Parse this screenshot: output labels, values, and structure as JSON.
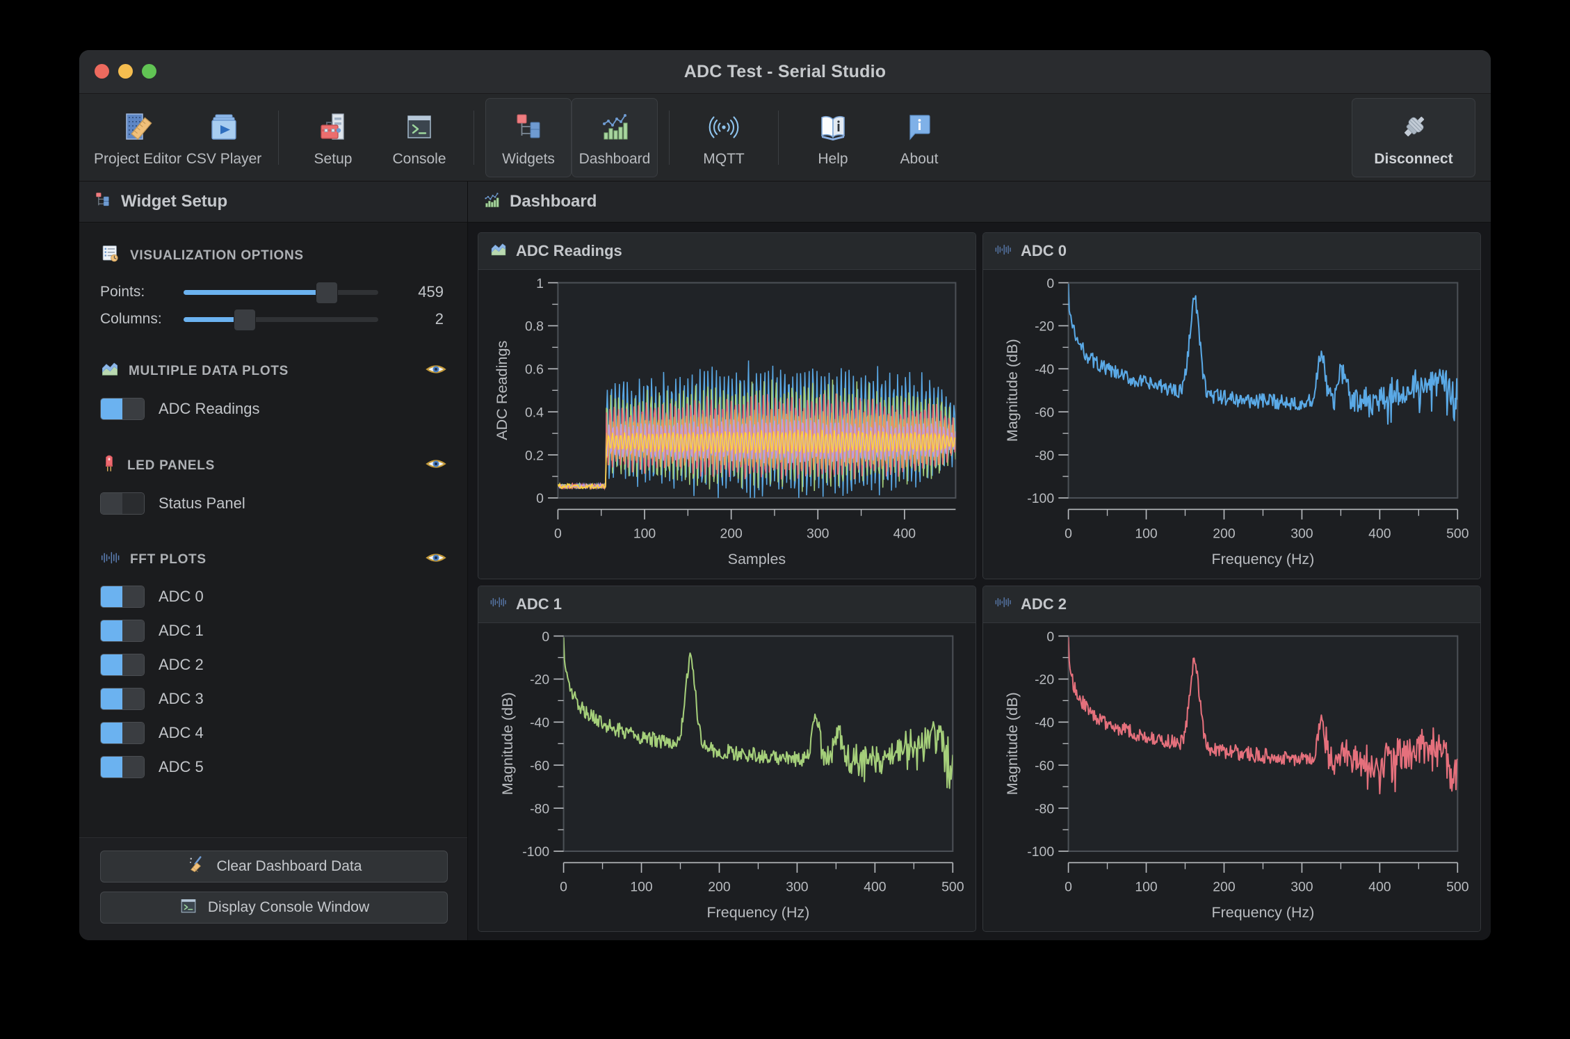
{
  "window": {
    "title": "ADC Test - Serial Studio",
    "traffic_lights": [
      "close-red",
      "minimize-yellow",
      "maximize-green"
    ]
  },
  "toolbar": {
    "buttons": [
      {
        "label": "Project Editor",
        "icon": "project-editor-icon",
        "active": false
      },
      {
        "label": "CSV Player",
        "icon": "csv-player-icon",
        "active": false
      },
      {
        "label": "Setup",
        "icon": "setup-toolbox-icon",
        "active": false
      },
      {
        "label": "Console",
        "icon": "console-terminal-icon",
        "active": false
      },
      {
        "label": "Widgets",
        "icon": "widgets-tree-icon",
        "active": true
      },
      {
        "label": "Dashboard",
        "icon": "dashboard-chart-icon",
        "active": true
      },
      {
        "label": "MQTT",
        "icon": "mqtt-signal-icon",
        "active": false
      },
      {
        "label": "Help",
        "icon": "help-book-icon",
        "active": false
      },
      {
        "label": "About",
        "icon": "about-info-icon",
        "active": false
      }
    ],
    "disconnect": {
      "label": "Disconnect",
      "icon": "connector-plug-icon"
    }
  },
  "sidebar": {
    "header": {
      "title": "Widget Setup",
      "icon": "widget-tree-icon"
    },
    "visualization": {
      "title": "VISUALIZATION OPTIONS",
      "icon": "visualization-options-icon",
      "points": {
        "label": "Points:",
        "value": "459",
        "percent": 70
      },
      "columns": {
        "label": "Columns:",
        "value": "2",
        "percent": 28
      }
    },
    "multiple_data_plots": {
      "title": "MULTIPLE DATA PLOTS",
      "icon": "area-chart-icon",
      "eye_icon": "eye-visible-icon",
      "items": [
        {
          "label": "ADC Readings",
          "enabled": true
        }
      ]
    },
    "led_panels": {
      "title": "LED PANELS",
      "icon": "led-icon",
      "eye_icon": "eye-visible-icon",
      "items": [
        {
          "label": "Status Panel",
          "enabled": false
        }
      ]
    },
    "fft_plots": {
      "title": "FFT PLOTS",
      "icon": "fft-waveform-icon",
      "eye_icon": "eye-visible-icon",
      "items": [
        {
          "label": "ADC 0",
          "enabled": true
        },
        {
          "label": "ADC 1",
          "enabled": true
        },
        {
          "label": "ADC 2",
          "enabled": true
        },
        {
          "label": "ADC 3",
          "enabled": true
        },
        {
          "label": "ADC 4",
          "enabled": true
        },
        {
          "label": "ADC 5",
          "enabled": true
        }
      ]
    },
    "footer": {
      "clear": {
        "label": "Clear Dashboard Data",
        "icon": "broom-icon"
      },
      "console": {
        "label": "Display Console Window",
        "icon": "console-terminal-icon"
      }
    }
  },
  "dashboard": {
    "header": {
      "title": "Dashboard",
      "icon": "dashboard-chart-icon"
    },
    "cards": [
      {
        "title": "ADC Readings",
        "icon": "area-chart-icon"
      },
      {
        "title": "ADC 0",
        "icon": "fft-waveform-icon"
      },
      {
        "title": "ADC 1",
        "icon": "fft-waveform-icon"
      },
      {
        "title": "ADC 2",
        "icon": "fft-waveform-icon"
      }
    ]
  },
  "colors": {
    "accent_blue": "#6bb2f0",
    "series_blue": "#5aa9e6",
    "series_green": "#a5cf7a",
    "series_red": "#e5707c",
    "series_purple": "#c29ae0",
    "series_orange": "#e8a05a",
    "series_yellow": "#ffd43b",
    "panel_bg": "#1c1e21",
    "window_bg": "#1f2123"
  },
  "chart_data": [
    {
      "type": "line",
      "title": "ADC Readings",
      "xlabel": "Samples",
      "ylabel": "ADC Readings",
      "xlim": [
        0,
        459
      ],
      "ylim": [
        0,
        1
      ],
      "xticks": [
        0,
        100,
        200,
        300,
        400
      ],
      "yticks": [
        0,
        0.2,
        0.4,
        0.6,
        0.8,
        1
      ],
      "grid": false,
      "legend": "none",
      "description": "Six overlapping oscillating ADC channels; flat near 0.05 for first ~55 samples then high-frequency oscillation between ~0.02 and ~0.60",
      "series": [
        {
          "name": "ADC 0",
          "color": "#5aa9e6",
          "band_min": 0.02,
          "band_max": 0.6,
          "baseline": 0.055
        },
        {
          "name": "ADC 1",
          "color": "#a5cf7a",
          "band_min": 0.06,
          "band_max": 0.52,
          "baseline": 0.055
        },
        {
          "name": "ADC 2",
          "color": "#e5707c",
          "band_min": 0.1,
          "band_max": 0.46,
          "baseline": 0.055
        },
        {
          "name": "ADC 3",
          "color": "#e8a05a",
          "band_min": 0.14,
          "band_max": 0.4,
          "baseline": 0.055
        },
        {
          "name": "ADC 4",
          "color": "#c29ae0",
          "band_min": 0.17,
          "band_max": 0.36,
          "baseline": 0.055
        },
        {
          "name": "ADC 5",
          "color": "#ffd43b",
          "band_min": 0.21,
          "band_max": 0.31,
          "baseline": 0.055
        }
      ]
    },
    {
      "type": "line",
      "title": "ADC 0",
      "xlabel": "Frequency (Hz)",
      "ylabel": "Magnitude (dB)",
      "xlim": [
        0,
        500
      ],
      "ylim": [
        -100,
        0
      ],
      "xticks": [
        0,
        100,
        200,
        300,
        400,
        500
      ],
      "yticks": [
        0,
        -20,
        -40,
        -60,
        -80,
        -100
      ],
      "grid": false,
      "color": "#5aa9e6",
      "peaks": [
        {
          "freq": 2,
          "db": 0
        },
        {
          "freq": 162,
          "db": -8
        },
        {
          "freq": 325,
          "db": -33
        },
        {
          "freq": 352,
          "db": -43
        },
        {
          "freq": 488,
          "db": -40
        }
      ],
      "noise_floor_db": -55
    },
    {
      "type": "line",
      "title": "ADC 1",
      "xlabel": "Frequency (Hz)",
      "ylabel": "Magnitude (dB)",
      "xlim": [
        0,
        500
      ],
      "ylim": [
        -100,
        0
      ],
      "xticks": [
        0,
        100,
        200,
        300,
        400,
        500
      ],
      "yticks": [
        0,
        -20,
        -40,
        -60,
        -80,
        -100
      ],
      "grid": false,
      "color": "#a5cf7a",
      "peaks": [
        {
          "freq": 2,
          "db": 0
        },
        {
          "freq": 163,
          "db": -10
        },
        {
          "freq": 324,
          "db": -37
        },
        {
          "freq": 353,
          "db": -46
        },
        {
          "freq": 489,
          "db": -44
        }
      ],
      "noise_floor_db": -58
    },
    {
      "type": "line",
      "title": "ADC 2",
      "xlabel": "Frequency (Hz)",
      "ylabel": "Magnitude (dB)",
      "xlim": [
        0,
        500
      ],
      "ylim": [
        -100,
        0
      ],
      "xticks": [
        0,
        100,
        200,
        300,
        400,
        500
      ],
      "yticks": [
        0,
        -20,
        -40,
        -60,
        -80,
        -100
      ],
      "grid": false,
      "color": "#e5707c",
      "peaks": [
        {
          "freq": 2,
          "db": 0
        },
        {
          "freq": 162,
          "db": -12
        },
        {
          "freq": 325,
          "db": -40
        },
        {
          "freq": 352,
          "db": -53
        },
        {
          "freq": 487,
          "db": -49
        }
      ],
      "noise_floor_db": -62
    }
  ]
}
